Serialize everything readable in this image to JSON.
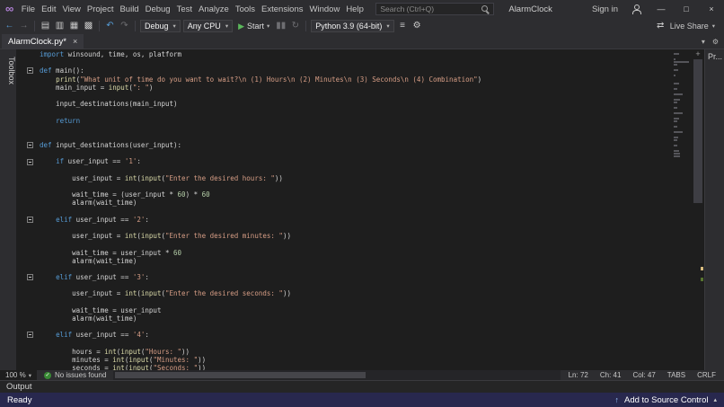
{
  "colors": {
    "chrome_bg": "#2d2d30",
    "editor_bg": "#1e1e1e",
    "status_bar_bg": "#28284e",
    "keyword_blue": "#569cd6",
    "string_orange": "#d69d85",
    "number_green": "#b5cea8",
    "builtin_yellow": "#dcdcaa",
    "plain_text": "#d4d4d4",
    "start_green": "#5bb75b",
    "issues_green": "#388a34",
    "logo_purple": "#b180d7"
  },
  "icons": {
    "logo": "∞",
    "back": "←",
    "forward": "→",
    "new_file": "▤",
    "open_file": "▥",
    "save": "▦",
    "save_all": "▩",
    "undo": "↶",
    "redo": "↷",
    "dropdown": "▾",
    "play": "▶",
    "pause": "▮▮",
    "refresh": "↻",
    "list": "≡",
    "gear": "⚙",
    "live_share": "⇄",
    "close": "×",
    "minimize": "—",
    "maximize": "□",
    "check": "✓",
    "plus": "+",
    "up_arrow": "↑",
    "expand": "▴"
  },
  "title_bar": {
    "menus": [
      "File",
      "Edit",
      "View",
      "Project",
      "Build",
      "Debug",
      "Test",
      "Analyze",
      "Tools",
      "Extensions",
      "Window",
      "Help"
    ],
    "search_placeholder": "Search (Ctrl+Q)",
    "window_title": "AlarmClock",
    "sign_in": "Sign in"
  },
  "toolbar": {
    "config": "Debug",
    "platform": "Any CPU",
    "start": "Start",
    "environment": "Python 3.9 (64-bit)",
    "live_share": "Live Share"
  },
  "tab_bar": {
    "tabs": [
      {
        "label": "AlarmClock.py*"
      }
    ],
    "properties_tab": "Pr..."
  },
  "toolbox_label": "Toolbox",
  "editor": {
    "lines": [
      {
        "tokens": [
          [
            "k",
            "import"
          ],
          [
            "p",
            " winsound, time, os, platform"
          ]
        ]
      },
      {
        "tokens": []
      },
      {
        "fold": true,
        "tokens": [
          [
            "k",
            "def"
          ],
          [
            "p",
            " main():"
          ]
        ]
      },
      {
        "tokens": [
          [
            "p",
            "    "
          ],
          [
            "b",
            "print"
          ],
          [
            "p",
            "("
          ],
          [
            "s",
            "\"What unit of time do you want to wait?\\n (1) Hours\\n (2) Minutes\\n (3) Seconds\\n (4) Combination\""
          ],
          [
            "p",
            ")"
          ]
        ]
      },
      {
        "tokens": [
          [
            "p",
            "    main_input = "
          ],
          [
            "b",
            "input"
          ],
          [
            "p",
            "("
          ],
          [
            "s",
            "\": \""
          ],
          [
            "p",
            ")"
          ]
        ]
      },
      {
        "tokens": []
      },
      {
        "tokens": [
          [
            "p",
            "    input_destinations(main_input)"
          ]
        ]
      },
      {
        "tokens": []
      },
      {
        "tokens": [
          [
            "p",
            "    "
          ],
          [
            "k",
            "return"
          ]
        ]
      },
      {
        "tokens": []
      },
      {
        "tokens": []
      },
      {
        "fold": true,
        "tokens": [
          [
            "k",
            "def"
          ],
          [
            "p",
            " input_destinations(user_input):"
          ]
        ]
      },
      {
        "tokens": []
      },
      {
        "fold": true,
        "tokens": [
          [
            "p",
            "    "
          ],
          [
            "k",
            "if"
          ],
          [
            "p",
            " user_input == "
          ],
          [
            "s",
            "'1'"
          ],
          [
            "p",
            ":"
          ]
        ]
      },
      {
        "tokens": []
      },
      {
        "tokens": [
          [
            "p",
            "        user_input = "
          ],
          [
            "b",
            "int"
          ],
          [
            "p",
            "("
          ],
          [
            "b",
            "input"
          ],
          [
            "p",
            "("
          ],
          [
            "s",
            "\"Enter the desired hours: \""
          ],
          [
            "p",
            "))"
          ]
        ]
      },
      {
        "tokens": []
      },
      {
        "tokens": [
          [
            "p",
            "        wait_time = (user_input * "
          ],
          [
            "n",
            "60"
          ],
          [
            "p",
            ") * "
          ],
          [
            "n",
            "60"
          ]
        ]
      },
      {
        "tokens": [
          [
            "p",
            "        alarm(wait_time)"
          ]
        ]
      },
      {
        "tokens": []
      },
      {
        "fold": true,
        "tokens": [
          [
            "p",
            "    "
          ],
          [
            "k",
            "elif"
          ],
          [
            "p",
            " user_input == "
          ],
          [
            "s",
            "'2'"
          ],
          [
            "p",
            ":"
          ]
        ]
      },
      {
        "tokens": []
      },
      {
        "tokens": [
          [
            "p",
            "        user_input = "
          ],
          [
            "b",
            "int"
          ],
          [
            "p",
            "("
          ],
          [
            "b",
            "input"
          ],
          [
            "p",
            "("
          ],
          [
            "s",
            "\"Enter the desired minutes: \""
          ],
          [
            "p",
            "))"
          ]
        ]
      },
      {
        "tokens": []
      },
      {
        "tokens": [
          [
            "p",
            "        wait_time = user_input * "
          ],
          [
            "n",
            "60"
          ]
        ]
      },
      {
        "tokens": [
          [
            "p",
            "        alarm(wait_time)"
          ]
        ]
      },
      {
        "tokens": []
      },
      {
        "fold": true,
        "tokens": [
          [
            "p",
            "    "
          ],
          [
            "k",
            "elif"
          ],
          [
            "p",
            " user_input == "
          ],
          [
            "s",
            "'3'"
          ],
          [
            "p",
            ":"
          ]
        ]
      },
      {
        "tokens": []
      },
      {
        "tokens": [
          [
            "p",
            "        user_input = "
          ],
          [
            "b",
            "int"
          ],
          [
            "p",
            "("
          ],
          [
            "b",
            "input"
          ],
          [
            "p",
            "("
          ],
          [
            "s",
            "\"Enter the desired seconds: \""
          ],
          [
            "p",
            "))"
          ]
        ]
      },
      {
        "tokens": []
      },
      {
        "tokens": [
          [
            "p",
            "        wait_time = user_input"
          ]
        ]
      },
      {
        "tokens": [
          [
            "p",
            "        alarm(wait_time)"
          ]
        ]
      },
      {
        "tokens": []
      },
      {
        "fold": true,
        "tokens": [
          [
            "p",
            "    "
          ],
          [
            "k",
            "elif"
          ],
          [
            "p",
            " user_input == "
          ],
          [
            "s",
            "'4'"
          ],
          [
            "p",
            ":"
          ]
        ]
      },
      {
        "tokens": []
      },
      {
        "tokens": [
          [
            "p",
            "        hours = "
          ],
          [
            "b",
            "int"
          ],
          [
            "p",
            "("
          ],
          [
            "b",
            "input"
          ],
          [
            "p",
            "("
          ],
          [
            "s",
            "\"Hours: \""
          ],
          [
            "p",
            "))"
          ]
        ]
      },
      {
        "tokens": [
          [
            "p",
            "        minutes = "
          ],
          [
            "b",
            "int"
          ],
          [
            "p",
            "("
          ],
          [
            "b",
            "input"
          ],
          [
            "p",
            "("
          ],
          [
            "s",
            "\"Minutes: \""
          ],
          [
            "p",
            "))"
          ]
        ]
      },
      {
        "tokens": [
          [
            "p",
            "        seconds = "
          ],
          [
            "b",
            "int"
          ],
          [
            "p",
            "("
          ],
          [
            "b",
            "input"
          ],
          [
            "p",
            "("
          ],
          [
            "s",
            "\"Seconds: \""
          ],
          [
            "p",
            "))"
          ]
        ]
      }
    ]
  },
  "editor_bottom": {
    "zoom": "100 %",
    "issues": "No issues found",
    "ln": "Ln: 72",
    "ch": "Ch: 41",
    "col": "Col: 47",
    "tabs_indicator": "TABS",
    "eol": "CRLF"
  },
  "output_panel": {
    "title": "Output"
  },
  "status_bar": {
    "ready": "Ready",
    "add_to_source_control": "Add to Source Control"
  }
}
